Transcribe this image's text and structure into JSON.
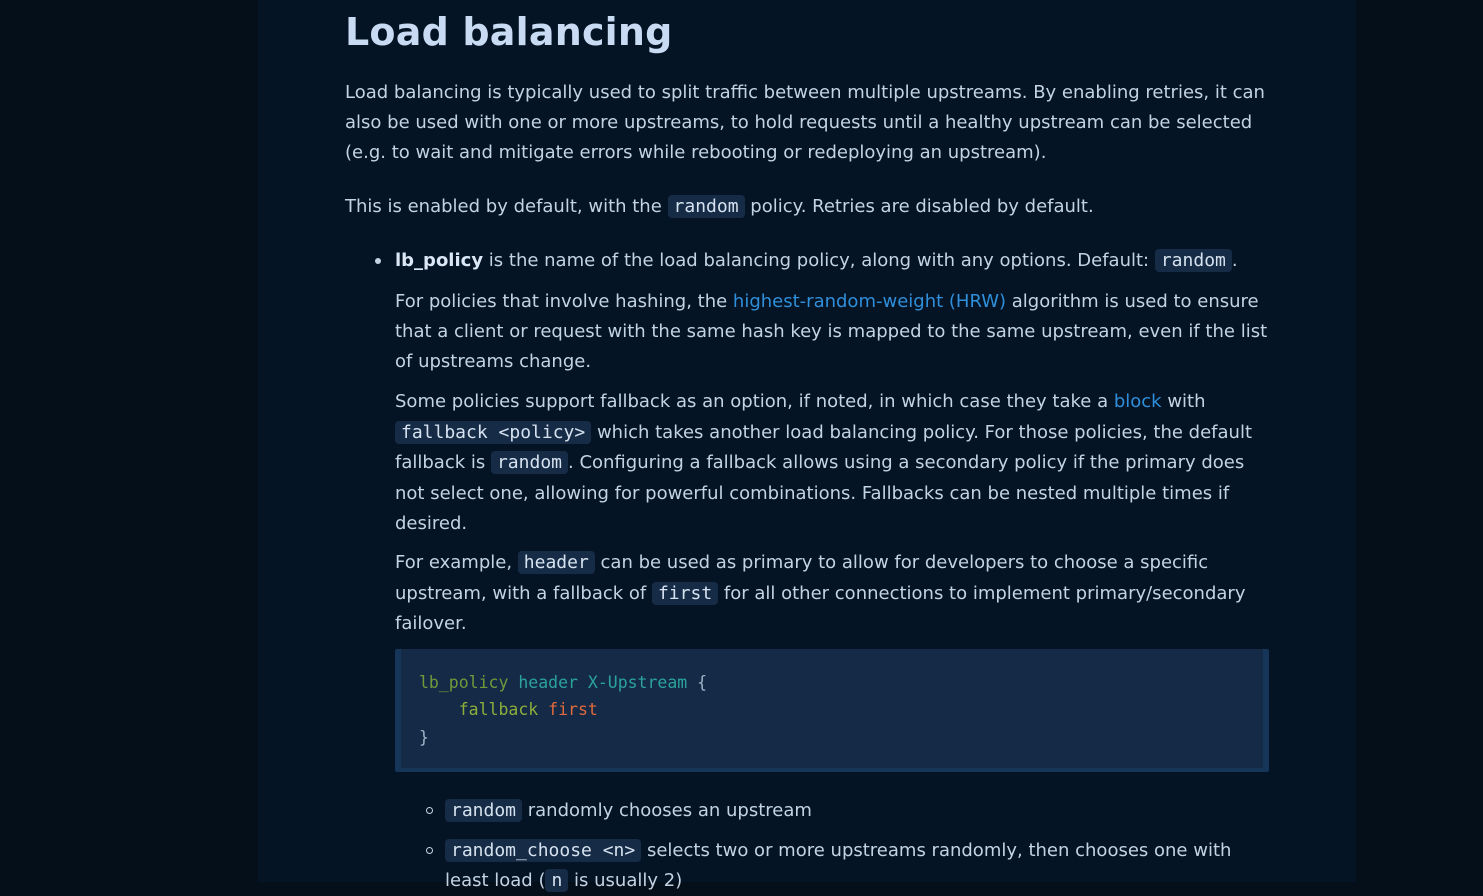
{
  "heading": "Load balancing",
  "intro": {
    "text": "Load balancing is typically used to split traffic between multiple upstreams. By enabling retries, it can also be used with one or more upstreams, to hold requests until a healthy upstream can be selected (e.g. to wait and mitigate errors while rebooting or redeploying an upstream)."
  },
  "default_para": {
    "before": "This is enabled by default, with the ",
    "code": "random",
    "after": " policy. Retries are disabled by default."
  },
  "lb_policy": {
    "term": "lb_policy",
    "desc": " is the name of the load balancing policy, along with any options. Default: ",
    "default_code": "random",
    "end": "."
  },
  "hrw_para": {
    "before": "For policies that involve hashing, the ",
    "link": "highest-random-weight (HRW)",
    "after": " algorithm is used to ensure that a client or request with the same hash key is mapped to the same upstream, even if the list of upstreams change."
  },
  "fallback_para": {
    "before": "Some policies support fallback as an option, if noted, in which case they take a ",
    "link": "block",
    "mid1": " with ",
    "code1": "fallback <policy>",
    "mid2": " which takes another load balancing policy. For those policies, the default fallback is ",
    "code2": "random",
    "after": ". Configuring a fallback allows using a secondary policy if the primary does not select one, allowing for powerful combinations. Fallbacks can be nested multiple times if desired."
  },
  "example_para": {
    "before": "For example, ",
    "code1": "header",
    "mid": " can be used as primary to allow for developers to choose a specific upstream, with a fallback of ",
    "code2": "first",
    "after": " for all other connections to implement primary/secondary failover."
  },
  "code_example": {
    "line1": {
      "directive": "lb_policy",
      "arg1": "header",
      "arg2": "X-Upstream",
      "brace": "{"
    },
    "line2": {
      "subdirective": "fallback",
      "value": "first"
    },
    "line3": {
      "brace": "}"
    }
  },
  "policies": [
    {
      "code": "random",
      "desc": " randomly chooses an upstream"
    },
    {
      "code": "random_choose <n>",
      "desc": " selects two or more upstreams randomly, then chooses one with least load (",
      "code2": "n",
      "desc2": " is usually 2)"
    }
  ],
  "colors": {
    "background": "#050f19",
    "article": "#051424",
    "link": "#2f8fdb",
    "code_bg": "#152b46"
  }
}
